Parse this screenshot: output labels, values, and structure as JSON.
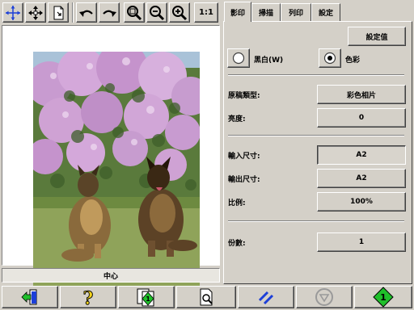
{
  "tabs": [
    {
      "label": "影印",
      "active": true
    },
    {
      "label": "掃描",
      "active": false
    },
    {
      "label": "列印",
      "active": false
    },
    {
      "label": "設定",
      "active": false
    }
  ],
  "toolbar": {
    "actual_size_label": "1:1"
  },
  "preview": {
    "position_label": "中心"
  },
  "settings": {
    "settings_button": "設定值",
    "color_mode": {
      "bw_label": "黑白(W)",
      "color_label": "色彩",
      "selected": "color"
    },
    "original_type": {
      "label": "原稿類型:",
      "value": "彩色相片"
    },
    "brightness": {
      "label": "亮度:",
      "value": "0"
    },
    "input_size": {
      "label": "輸入尺寸:",
      "value": "A2"
    },
    "output_size": {
      "label": "輸出尺寸:",
      "value": "A2"
    },
    "scale": {
      "label": "比例:",
      "value": "100%"
    },
    "copies": {
      "label": "份數:",
      "value": "1"
    }
  },
  "colors": {
    "accent_blue": "#1c3fd8",
    "go_green": "#1fbf2a",
    "help_yellow": "#f2d21c",
    "stop_gray": "#9a9a9a"
  },
  "icons": {
    "toolbar": [
      "move-crosshair-icon",
      "pan-arrows-icon",
      "fit-page-icon",
      "undo-icon",
      "redo-icon",
      "zoom-icon",
      "zoom-out-icon",
      "zoom-in-icon"
    ],
    "bottom": [
      "exit-icon",
      "help-icon",
      "copy-start-icon",
      "preview-icon",
      "scan-icon",
      "stop-icon",
      "start-icon"
    ]
  }
}
